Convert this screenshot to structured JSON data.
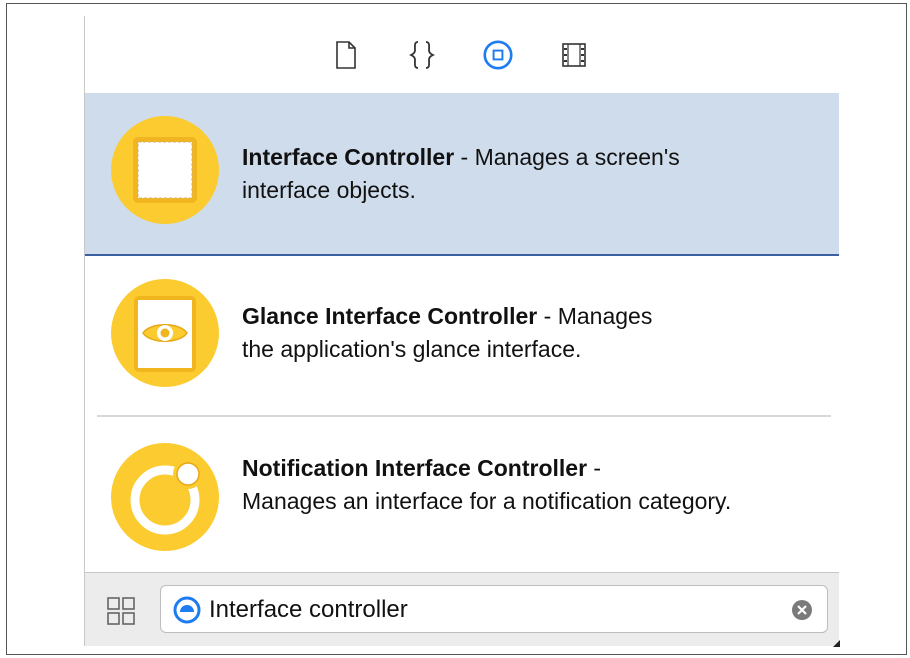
{
  "tabs": [
    {
      "icon": "file-template-icon",
      "active": false
    },
    {
      "icon": "code-snippet-icon",
      "active": false
    },
    {
      "icon": "object-library-icon",
      "active": true
    },
    {
      "icon": "media-library-icon",
      "active": false
    }
  ],
  "items": [
    {
      "title": "Interface Controller",
      "separator": " - ",
      "desc_first": "Manages a screen's",
      "desc_rest": "interface objects.",
      "icon": "interface-controller-icon"
    },
    {
      "title": "Glance Interface Controller",
      "separator": " - ",
      "desc_first": "Manages",
      "desc_rest": "the application's glance interface.",
      "icon": "glance-controller-icon"
    },
    {
      "title": "Notification Interface Controller",
      "separator": " -",
      "desc_first": "",
      "desc_rest": "Manages an interface for a notification category.",
      "icon": "notification-controller-icon"
    }
  ],
  "filter": {
    "value": "Interface controller",
    "grid_icon": "grid-view-icon",
    "scope_icon": "filter-scope-icon",
    "clear_icon": "clear-search-icon"
  },
  "colors": {
    "accent": "#1e7cf2",
    "selection": "#cfdcec",
    "icon_yellow": "#fbcb2f",
    "icon_yellow_dark": "#f0b51f"
  }
}
